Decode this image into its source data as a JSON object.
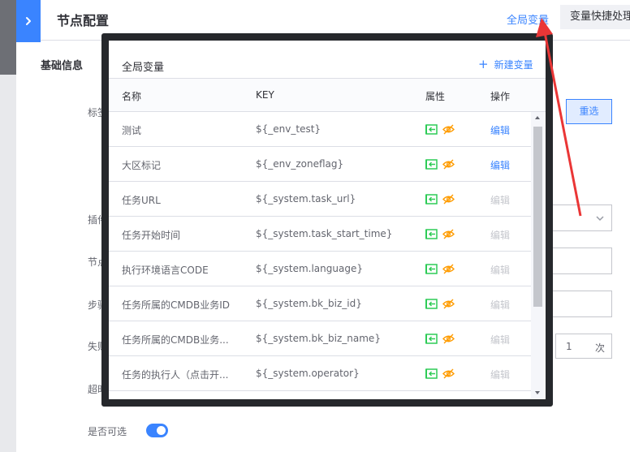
{
  "header": {
    "title": "节点配置",
    "global_var_link": "全局变量",
    "quick_btn": "变量快捷处理"
  },
  "section": {
    "title": "基础信息"
  },
  "form": {
    "labels": [
      "标签",
      "插件",
      "节点",
      "步骤",
      "失败",
      "超时",
      "是否可选"
    ],
    "reset_label": "重选",
    "retry_suffix": "次",
    "retry_count": "1",
    "retry_unit": "次",
    "optional_enabled": true
  },
  "popup": {
    "title": "全局变量",
    "new_var_label": "新建变量",
    "columns": {
      "name": "名称",
      "key": "KEY",
      "attr": "属性",
      "op": "操作"
    },
    "rows": [
      {
        "name": "测试",
        "key": "${_env_test}",
        "op": "编辑",
        "op_enabled": true
      },
      {
        "name": "大区标记",
        "key": "${_env_zoneflag}",
        "op": "编辑",
        "op_enabled": true
      },
      {
        "name": "任务URL",
        "key": "${_system.task_url}",
        "op": "编辑",
        "op_enabled": false
      },
      {
        "name": "任务开始时间",
        "key": "${_system.task_start_time}",
        "op": "编辑",
        "op_enabled": false
      },
      {
        "name": "执行环境语言CODE",
        "key": "${_system.language}",
        "op": "编辑",
        "op_enabled": false
      },
      {
        "name": "任务所属的CMDB业务ID",
        "key": "${_system.bk_biz_id}",
        "op": "编辑",
        "op_enabled": false
      },
      {
        "name": "任务所属的CMDB业务...",
        "key": "${_system.bk_biz_name}",
        "op": "编辑",
        "op_enabled": false
      },
      {
        "name": "任务的执行人（点击开...",
        "key": "${_system.operator}",
        "op": "编辑",
        "op_enabled": false
      }
    ]
  },
  "colors": {
    "primary": "#3a84ff",
    "attr_input_icon": "#2dcb56",
    "attr_visibility_icon": "#ff9c01",
    "disabled_text": "#c4c6cc",
    "annotation_arrow": "#ea3636"
  },
  "icons": {
    "collapse": "chevron-right-icon",
    "attr_input": "input-icon",
    "attr_visibility": "eye-off-icon",
    "new": "plus-icon"
  }
}
